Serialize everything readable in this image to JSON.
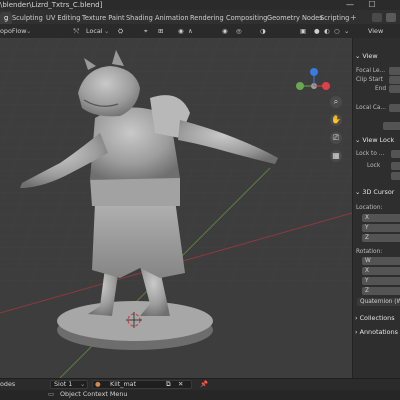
{
  "titlebar": {
    "path": "\\blender\\Lizrd_Txtrs_C.blend]",
    "minimize": "—",
    "maximize": "☐"
  },
  "tabs": {
    "items": [
      {
        "label": "g",
        "active": true
      },
      {
        "label": "Sculpting",
        "active": false
      },
      {
        "label": "UV Editing",
        "active": false
      },
      {
        "label": "Texture Paint",
        "active": false
      },
      {
        "label": "Shading",
        "active": false
      },
      {
        "label": "Animation",
        "active": false
      },
      {
        "label": "Rendering",
        "active": false
      },
      {
        "label": "Compositing",
        "active": false
      },
      {
        "label": "Geometry Nodes",
        "active": false
      },
      {
        "label": "Scripting",
        "active": false
      }
    ],
    "plus": "+"
  },
  "header": {
    "mode": "opoFlow",
    "orientation": "Local",
    "view": "View"
  },
  "sidebar": {
    "view_header": "View",
    "focal_label": "Focal Le...",
    "clip_start_label": "Clip Start",
    "end_label": "End",
    "local_camera_label": "Local Ca...",
    "view_lock_header": "View Lock",
    "lock_to_label": "Lock to ...",
    "lock_label": "Lock",
    "cursor_header": "3D Cursor",
    "location_label": "Location:",
    "x": "X",
    "y": "Y",
    "z": "Z",
    "rotation_label": "Rotation:",
    "w": "W",
    "quaternion": "Quaternion (WX",
    "collections": "Collections",
    "annotations": "Annotations"
  },
  "status": {
    "nodes": "odes",
    "slot": "Slot 1",
    "material": "Kilt_mat",
    "context_menu": "Object Context Menu"
  },
  "gizmo": {
    "x_color": "#e0404a",
    "y_color": "#6aa84f",
    "z_color": "#3a7be0"
  }
}
